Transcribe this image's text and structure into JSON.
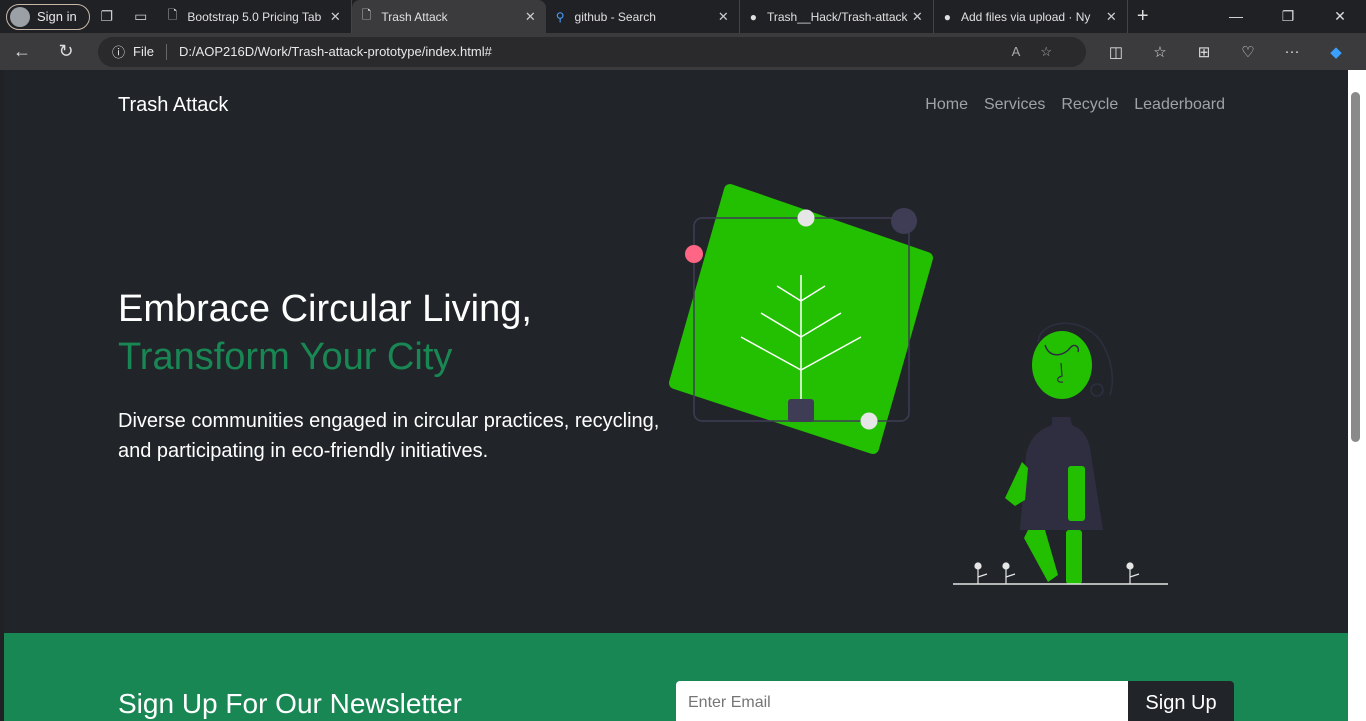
{
  "browser": {
    "sign_in": "Sign in",
    "tabs": [
      {
        "title": "Bootstrap 5.0 Pricing Tab",
        "icon": "page-icon"
      },
      {
        "title": "Trash Attack",
        "icon": "page-icon",
        "active": true
      },
      {
        "title": "github - Search",
        "icon": "search-icon"
      },
      {
        "title": "Trash__Hack/Trash-attack",
        "icon": "github-icon"
      },
      {
        "title": "Add files via upload · Ny",
        "icon": "github-icon"
      }
    ],
    "address_label": "File",
    "url": "D:/AOP216D/Work/Trash-attack-prototype/index.html#"
  },
  "navbar": {
    "brand": "Trash Attack",
    "links": [
      "Home",
      "Services",
      "Recycle",
      "Leaderboard"
    ]
  },
  "hero": {
    "title_line1": "Embrace Circular Living,",
    "title_line2": "Transform Your City",
    "lead": "Diverse communities engaged in circular practices, recycling, and participating in eco-friendly initiatives."
  },
  "newsletter": {
    "title": "Sign Up For Our Newsletter",
    "email_placeholder": "Enter Email",
    "button": "Sign Up"
  },
  "colors": {
    "accent": "#198754",
    "background": "#212529",
    "illustration_green": "#22c000",
    "illustration_dark": "#3f3d56",
    "pink": "#ff6584"
  }
}
